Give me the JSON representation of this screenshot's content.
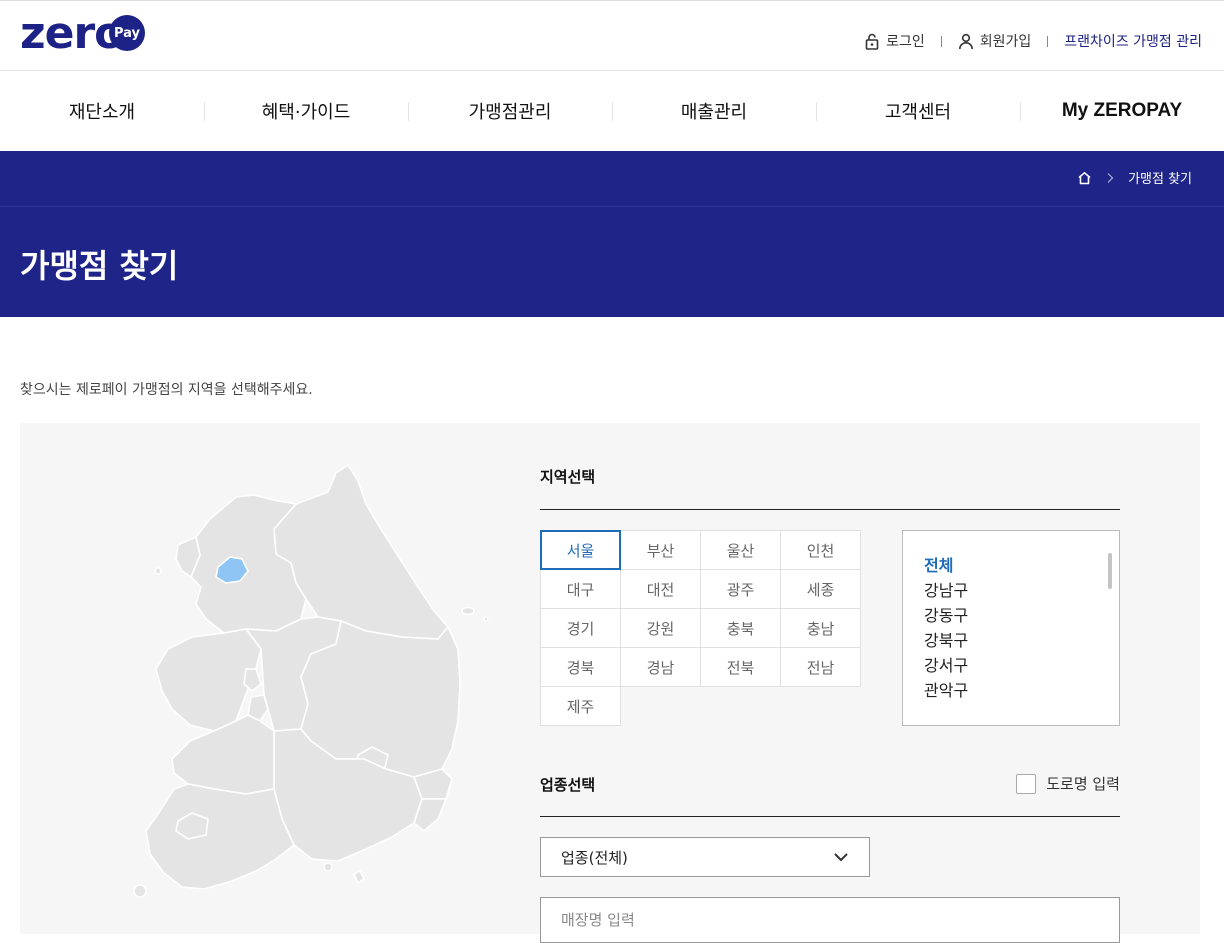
{
  "header": {
    "logo_text": "zero",
    "logo_badge": "Pay",
    "util": {
      "login": "로그인",
      "signup": "회원가입",
      "franchise": "프랜차이즈 가맹점 관리"
    }
  },
  "gnb": [
    "재단소개",
    "혜택·가이드",
    "가맹점관리",
    "매출관리",
    "고객센터",
    "My ZEROPAY"
  ],
  "breadcrumb": {
    "current": "가맹점 찾기",
    "home_icon": "home-icon",
    "separator": ">"
  },
  "page_title": "가맹점 찾기",
  "intro_text": "찾으시는 제로페이 가맹점의 지역을 선택해주세요.",
  "region_section": {
    "title": "지역선택",
    "regions": [
      "서울",
      "부산",
      "울산",
      "인천",
      "대구",
      "대전",
      "광주",
      "세종",
      "경기",
      "강원",
      "충북",
      "충남",
      "경북",
      "경남",
      "전북",
      "전남",
      "제주"
    ],
    "selected_region": "서울",
    "districts": [
      "전체",
      "강남구",
      "강동구",
      "강북구",
      "강서구",
      "관악구"
    ],
    "selected_district": "전체"
  },
  "category_section": {
    "title": "업종선택",
    "road_name_label": "도로명 입력",
    "road_name_checked": false,
    "category_value": "업종(전체)",
    "store_placeholder": "매장명 입력"
  },
  "colors": {
    "brand": "#1f2588",
    "accent": "#1f6bb8",
    "map_land": "#e4e4e4",
    "map_selected": "#8ec5f5"
  }
}
